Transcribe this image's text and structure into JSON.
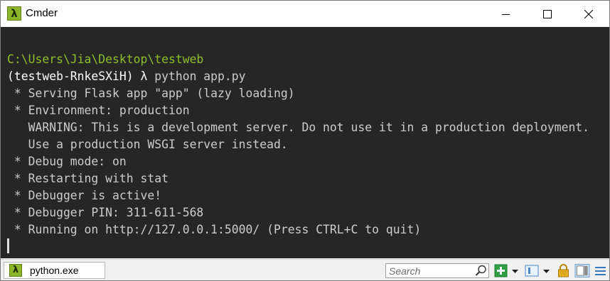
{
  "window": {
    "title": "Cmder",
    "app_icon_glyph": "λ"
  },
  "terminal": {
    "path_line": "C:\\Users\\Jia\\Desktop\\testweb",
    "prompt_env": "(testweb-RnkeSXiH) λ ",
    "command": "python app.py",
    "output": [
      " * Serving Flask app \"app\" (lazy loading)",
      " * Environment: production",
      "   WARNING: This is a development server. Do not use it in a production deployment.",
      "   Use a production WSGI server instead.",
      " * Debug mode: on",
      " * Restarting with stat",
      " * Debugger is active!",
      " * Debugger PIN: 311-611-568",
      " * Running on http://127.0.0.1:5000/ (Press CTRL+C to quit)"
    ]
  },
  "statusbar": {
    "tab_label": "python.exe",
    "tab_icon_glyph": "λ",
    "search_placeholder": "Search"
  },
  "colors": {
    "terminal_bg": "#262626",
    "terminal_text": "#cccccc",
    "path_green": "#8dbe2a",
    "prompt_white": "#ffffff",
    "icon_green": "#8cb62a"
  },
  "icons": [
    "lambda-icon",
    "minimize-icon",
    "maximize-icon",
    "close-icon",
    "search-icon",
    "add-console-icon",
    "dropdown-icon",
    "view-icon",
    "lock-icon",
    "layout-icon",
    "menu-icon"
  ]
}
